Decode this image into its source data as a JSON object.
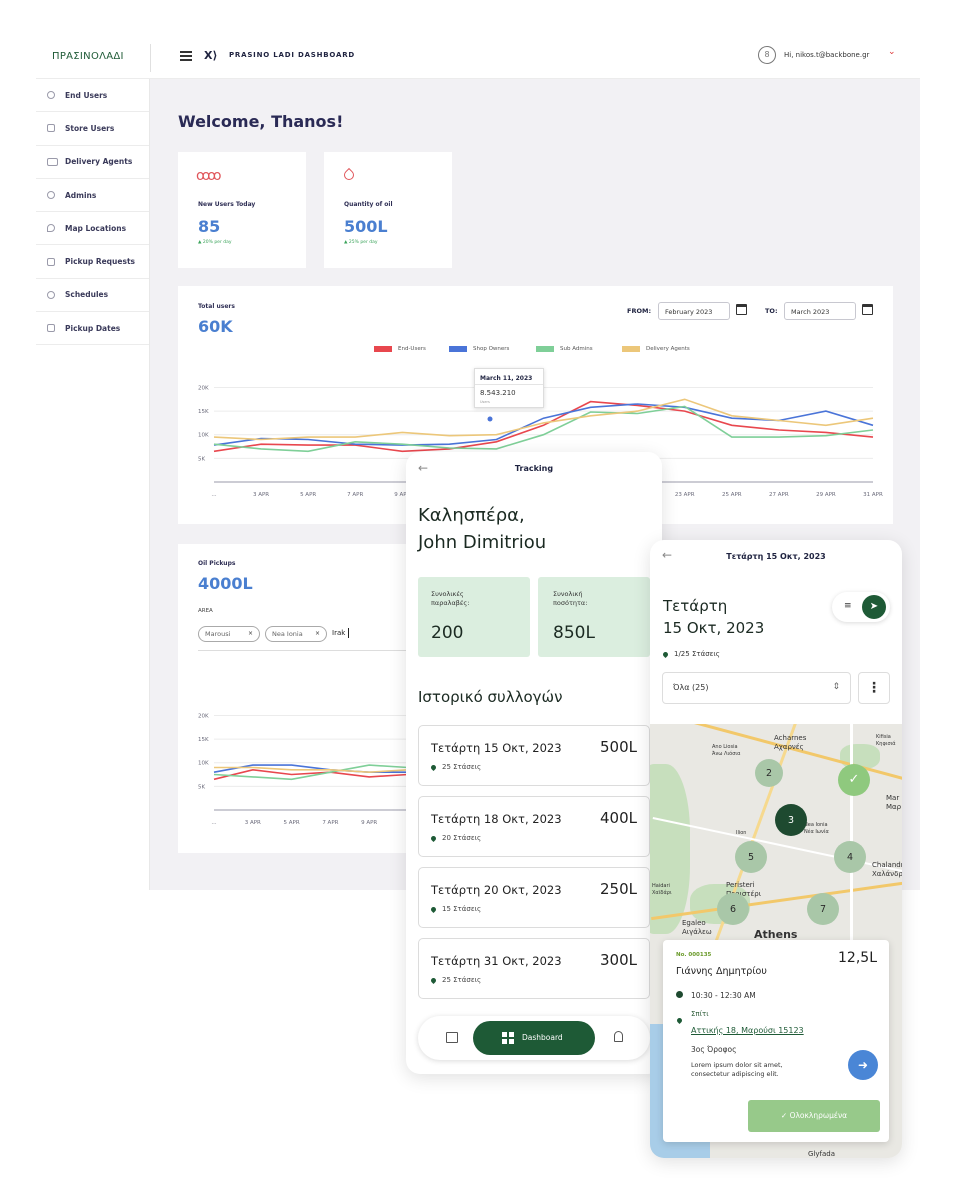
{
  "header": {
    "logo": "ΠΡΑΣΙΝΟΛΑΔΙ",
    "title": "PRASINO LADI DASHBOARD",
    "user": "Hi, nikos.t@backbone.gr"
  },
  "sidebar": {
    "items": [
      {
        "label": "End Users",
        "icon": "user-icon"
      },
      {
        "label": "Store Users",
        "icon": "store-icon"
      },
      {
        "label": "Delivery Agents",
        "icon": "truck-icon"
      },
      {
        "label": "Admins",
        "icon": "users-icon"
      },
      {
        "label": "Map Locations",
        "icon": "location-icon"
      },
      {
        "label": "Pickup Requests",
        "icon": "request-icon"
      },
      {
        "label": "Schedules",
        "icon": "clock-icon"
      },
      {
        "label": "Pickup Dates",
        "icon": "calendar-icon"
      }
    ]
  },
  "welcome": "Welcome, Thanos!",
  "stats": [
    {
      "label": "New Users Today",
      "value": "85",
      "change": "▲ 20% per day"
    },
    {
      "label": "Quantity of oil",
      "value": "500L",
      "change": "▲ 25% per day"
    }
  ],
  "total_users": {
    "title": "Total users",
    "value": "60K",
    "from_label": "FROM:",
    "from_value": "February 2023",
    "to_label": "TO:",
    "to_value": "March 2023",
    "tooltip": {
      "date": "March 11, 2023",
      "value": "8.543.210",
      "sub": "Users"
    }
  },
  "oil_pickups": {
    "title": "Oil Pickups",
    "value": "4000L",
    "area_label": "AREA",
    "tags": [
      "Marousi",
      "Nea Ionia"
    ],
    "input_value": "Irak"
  },
  "colors": {
    "end_users": "#e8474e",
    "shop_owners": "#4a74d8",
    "sub_admins": "#7fcf98",
    "delivery_agents": "#ecc77a",
    "brand_green": "#1e5a36"
  },
  "chart_data": [
    {
      "type": "line",
      "title": "Total users",
      "x": [
        "...",
        "3 APR",
        "5 APR",
        "7 APR",
        "9 APR",
        "1",
        "",
        "",
        "",
        "",
        "23 APR",
        "25 APR",
        "27 APR",
        "29 APR",
        "31 APR"
      ],
      "yticks": [
        "20K",
        "15K",
        "10K",
        "5K"
      ],
      "ylim": [
        0,
        22000
      ],
      "series": [
        {
          "name": "End-Users",
          "values": [
            6500,
            8000,
            7800,
            7800,
            6500,
            7000,
            8500,
            12000,
            17000,
            16200,
            15000,
            12000,
            11000,
            10500,
            9500
          ]
        },
        {
          "name": "Shop Owners",
          "values": [
            7800,
            9200,
            9000,
            8000,
            7800,
            8000,
            9000,
            13500,
            15800,
            16500,
            15800,
            13500,
            13000,
            15000,
            12000
          ]
        },
        {
          "name": "Sub Admins",
          "values": [
            8000,
            7000,
            6500,
            8500,
            8000,
            7200,
            7000,
            10000,
            14800,
            14500,
            16000,
            9500,
            9500,
            9800,
            11000
          ]
        },
        {
          "name": "Delivery Agents",
          "values": [
            9500,
            9000,
            9500,
            9500,
            10500,
            9800,
            10000,
            12500,
            14000,
            15000,
            17500,
            14000,
            13000,
            12000,
            13500
          ]
        }
      ]
    },
    {
      "type": "line",
      "title": "Oil Pickups",
      "x": [
        "...",
        "3 APR",
        "5 APR",
        "7 APR",
        "9 APR",
        "1"
      ],
      "yticks": [
        "20K",
        "15K",
        "10K",
        "5K"
      ],
      "ylim": [
        0,
        22000
      ],
      "series": [
        {
          "values": [
            6500,
            8500,
            7500,
            8000,
            7000,
            7500
          ]
        },
        {
          "values": [
            8000,
            9500,
            9500,
            8500,
            8000,
            8000
          ]
        },
        {
          "values": [
            7500,
            7000,
            6500,
            8000,
            9500,
            9000
          ]
        },
        {
          "values": [
            9000,
            9000,
            8500,
            8500,
            8000,
            8500
          ]
        }
      ]
    }
  ],
  "tracking": {
    "header": "Tracking",
    "greeting": "Καλησπέρα,",
    "name": "John Dimitriou",
    "tiles": [
      {
        "label": "Συνολικές παραλαβές:",
        "value": "200"
      },
      {
        "label": "Συνολική ποσότητα:",
        "value": "850L"
      }
    ],
    "history_title": "Ιστορικό συλλογών",
    "history": [
      {
        "date": "Τετάρτη 15 Οκτ, 2023",
        "amount": "500L",
        "stops": "25 Στάσεις"
      },
      {
        "date": "Τετάρτη 18 Οκτ, 2023",
        "amount": "400L",
        "stops": "20 Στάσεις"
      },
      {
        "date": "Τετάρτη 20 Οκτ, 2023",
        "amount": "250L",
        "stops": "15 Στάσεις"
      },
      {
        "date": "Τετάρτη 31 Οκτ, 2023",
        "amount": "300L",
        "stops": "25 Στάσεις"
      }
    ],
    "nav_dashboard": "Dashboard"
  },
  "map_screen": {
    "header": "Τετάρτη 15 Οκτ, 2023",
    "day": "Τετάρτη",
    "date": "15 Οκτ, 2023",
    "stops": "1/25 Στάσεις",
    "filter": "Όλα (25)",
    "map_labels": [
      "Acharnes",
      "Αχαρνές",
      "Ano Liosia",
      "Άνω Λιόσια",
      "Kifisia",
      "Κηφισιά",
      "Mar",
      "Μαρ",
      "Nea Ionia",
      "Νέα Ιωνία",
      "Ilion",
      "Chalandri",
      "Χαλάνδρι",
      "Peristeri",
      "Περιστέρι",
      "Haidari",
      "Χαϊδάρι",
      "Egaleo",
      "Αιγάλεω",
      "Athens",
      "Glyfada"
    ],
    "clusters": [
      "2",
      "3",
      "5",
      "4",
      "6",
      "7"
    ],
    "order": {
      "number": "No. 000135",
      "amount": "12,5L",
      "name": "Γιάννης Δημητρίου",
      "time": "10:30 - 12:30 AM",
      "place": "Σπίτι",
      "address": "Αττικής 18, Μαρούσι 15123",
      "floor": "3ος Όροφος",
      "note": "Lorem ipsum dolor sit amet, consectetur adipiscing elit.",
      "button": "Ολοκληρωμένα"
    }
  }
}
